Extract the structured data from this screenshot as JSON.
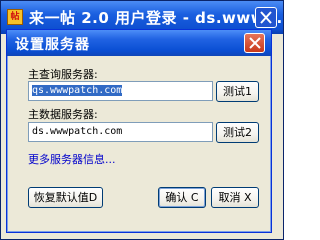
{
  "outer_window": {
    "title": "来一帖 2.0 用户登录 - ds.www..."
  },
  "dialog": {
    "title": "设置服务器",
    "query_server_label": "主查询服务器:",
    "query_server_value": "qs.wwwpatch.com",
    "query_test_button": "测试1",
    "data_server_label": "主数据服务器:",
    "data_server_value": "ds.wwwpatch.com",
    "data_test_button": "测试2",
    "more_info_link": "更多服务器信息...",
    "restore_default_button": "恢复默认值D",
    "ok_button": "确认 C",
    "cancel_button": "取消 X"
  },
  "colors": {
    "titlebar_blue": "#0a4ed3",
    "dialog_bg": "#ece9d8",
    "link": "#0000cc",
    "selection": "#316ac5"
  }
}
